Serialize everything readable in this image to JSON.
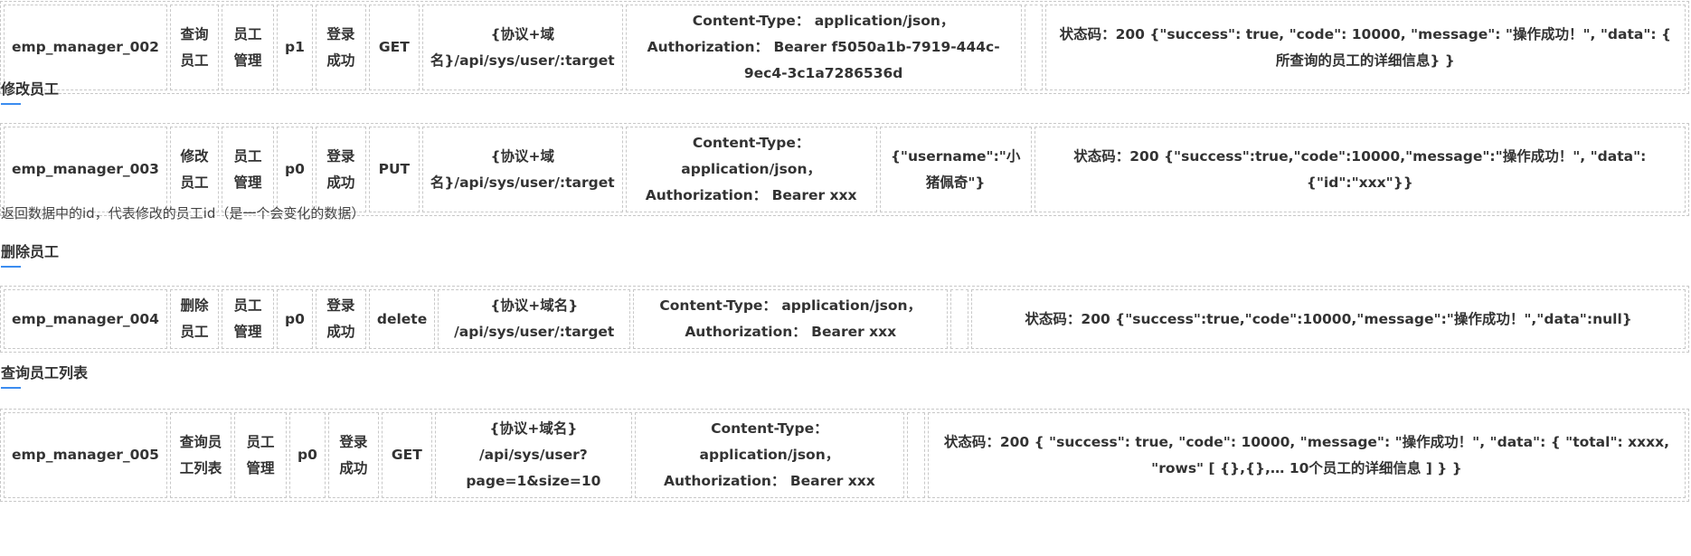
{
  "rows": [
    {
      "id": "emp_manager_002",
      "name": "查询员工",
      "module": "员工管理",
      "priority": "p1",
      "precondition": "登录成功",
      "method": "GET",
      "url": "{协议+域名}/api/sys/user/:target",
      "headers": "Content-Type： application/json， Authorization： Bearer f5050a1b-7919-444c-9ec4-3c1a7286536d",
      "body": "",
      "expected": "状态码：200 {\"success\": true, \"code\": 10000, \"message\": \"操作成功！\", \"data\": { 所查询的员工的详细信息} }"
    },
    {
      "id": "emp_manager_003",
      "name": "修改员工",
      "module": "员工管理",
      "priority": "p0",
      "precondition": "登录成功",
      "method": "PUT",
      "url": "{协议+域名}/api/sys/user/:target",
      "headers": "Content-Type： application/json， Authorization： Bearer xxx",
      "body": "{\"username\":\"小猪佩奇\"}",
      "expected": "状态码：200 {\"success\":true,\"code\":10000,\"message\":\"操作成功！\", \"data\":{\"id\":\"xxx\"}}"
    },
    {
      "id": "emp_manager_004",
      "name": "删除员工",
      "module": "员工管理",
      "priority": "p0",
      "precondition": "登录成功",
      "method": "delete",
      "url": "{协议+域名} /api/sys/user/:target",
      "headers": "Content-Type： application/json， Authorization： Bearer xxx",
      "body": "",
      "expected": "状态码：200 {\"success\":true,\"code\":10000,\"message\":\"操作成功！\",\"data\":null}"
    },
    {
      "id": "emp_manager_005",
      "name": "查询员工列表",
      "module": "员工管理",
      "priority": "p0",
      "precondition": "登录成功",
      "method": "GET",
      "url": "{协议+域名} /api/sys/user?page=1&size=10",
      "headers": "Content-Type： application/json， Authorization： Bearer xxx",
      "body": "",
      "expected": "状态码：200 { \"success\": true, \"code\": 10000, \"message\": \"操作成功！\", \"data\": { \"total\": xxxx, \"rows\" [ {},{},… 10个员工的详细信息 ] } }"
    }
  ],
  "headings": {
    "edit": "修改员工",
    "delete": "删除员工",
    "list": "查询员工列表"
  },
  "note": "返回数据中的id，代表修改的员工id（是一个会变化的数据）",
  "colors": {
    "accent": "#3b8cf0",
    "border": "#c8c8c8",
    "text": "#333333"
  }
}
